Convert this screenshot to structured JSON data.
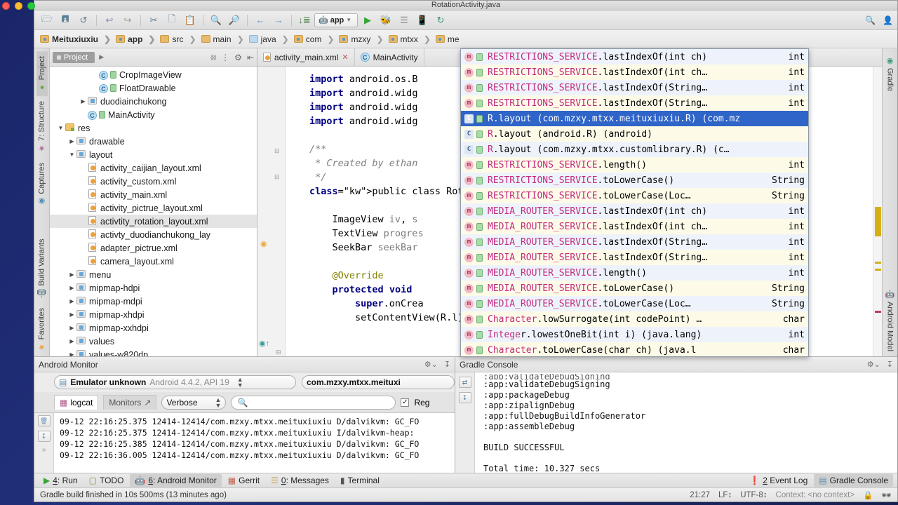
{
  "window": {
    "title": "RotationActivity.java"
  },
  "toolbar": {
    "icons": [
      "open-folder-icon",
      "save-icon",
      "sync-icon",
      "undo-icon",
      "redo-icon",
      "cut-icon",
      "copy-icon",
      "paste-icon",
      "find-icon",
      "find-replace-icon",
      "back-icon",
      "forward-icon",
      "sort-icon"
    ],
    "run_config_label": "app",
    "run_icons": [
      "run-icon",
      "debug-icon",
      "coverage-icon",
      "device-icon",
      "refresh-icon"
    ],
    "right_icons": [
      "search-icon",
      "avatar-icon"
    ]
  },
  "breadcrumb": {
    "items": [
      {
        "label": "Meituxiuxiu",
        "icon": "module-folder-icon",
        "bold": true
      },
      {
        "label": "app",
        "icon": "module-folder-icon",
        "bold": true
      },
      {
        "label": "src",
        "icon": "folder-icon",
        "bold": false
      },
      {
        "label": "main",
        "icon": "folder-icon",
        "bold": false
      },
      {
        "label": "java",
        "icon": "source-folder-icon",
        "bold": false
      },
      {
        "label": "com",
        "icon": "package-folder-icon",
        "bold": false
      },
      {
        "label": "mzxy",
        "icon": "package-folder-icon",
        "bold": false
      },
      {
        "label": "mtxx",
        "icon": "package-folder-icon",
        "bold": false
      },
      {
        "label": "me",
        "icon": "package-folder-icon",
        "bold": false
      }
    ]
  },
  "left_strip": {
    "tabs": [
      "Project",
      "7: Structure",
      "Captures",
      "Build Variants",
      "Favorites"
    ]
  },
  "right_strip": {
    "tabs": [
      "Gradle",
      "Android Model"
    ]
  },
  "project_panel": {
    "tab_label": "Project",
    "tree": [
      {
        "depth": 4,
        "arrow": "none",
        "icon": "class-icon",
        "label": "CropImageView"
      },
      {
        "depth": 4,
        "arrow": "none",
        "icon": "class-icon",
        "label": "FloatDrawable"
      },
      {
        "depth": 3,
        "arrow": "collapsed",
        "icon": "folder-icon",
        "label": "duodiainchukong"
      },
      {
        "depth": 3,
        "arrow": "none",
        "icon": "class-icon",
        "label": "MainActivity"
      },
      {
        "depth": 1,
        "arrow": "expanded",
        "icon": "res-folder-icon",
        "label": "res"
      },
      {
        "depth": 2,
        "arrow": "collapsed",
        "icon": "folder-icon",
        "label": "drawable"
      },
      {
        "depth": 2,
        "arrow": "expanded",
        "icon": "folder-icon",
        "label": "layout"
      },
      {
        "depth": 3,
        "arrow": "none",
        "icon": "xml-icon",
        "label": "activity_caijian_layout.xml"
      },
      {
        "depth": 3,
        "arrow": "none",
        "icon": "xml-icon",
        "label": "activity_custom.xml"
      },
      {
        "depth": 3,
        "arrow": "none",
        "icon": "xml-icon",
        "label": "activity_main.xml"
      },
      {
        "depth": 3,
        "arrow": "none",
        "icon": "xml-icon",
        "label": "activity_pictrue_layout.xml"
      },
      {
        "depth": 3,
        "arrow": "none",
        "icon": "xml-icon",
        "label": "activtity_rotation_layout.xml",
        "selected": true
      },
      {
        "depth": 3,
        "arrow": "none",
        "icon": "xml-icon",
        "label": "activty_duodianchukong_lay"
      },
      {
        "depth": 3,
        "arrow": "none",
        "icon": "xml-icon",
        "label": "adapter_pictrue.xml"
      },
      {
        "depth": 3,
        "arrow": "none",
        "icon": "xml-icon",
        "label": "camera_layout.xml"
      },
      {
        "depth": 2,
        "arrow": "collapsed",
        "icon": "folder-icon",
        "label": "menu"
      },
      {
        "depth": 2,
        "arrow": "collapsed",
        "icon": "folder-icon",
        "label": "mipmap-hdpi"
      },
      {
        "depth": 2,
        "arrow": "collapsed",
        "icon": "folder-icon",
        "label": "mipmap-mdpi"
      },
      {
        "depth": 2,
        "arrow": "collapsed",
        "icon": "folder-icon",
        "label": "mipmap-xhdpi"
      },
      {
        "depth": 2,
        "arrow": "collapsed",
        "icon": "folder-icon",
        "label": "mipmap-xxhdpi"
      },
      {
        "depth": 2,
        "arrow": "collapsed",
        "icon": "folder-icon",
        "label": "values"
      },
      {
        "depth": 2,
        "arrow": "collapsed",
        "icon": "folder-icon",
        "label": "values-w820dp"
      }
    ]
  },
  "editor": {
    "tabs": [
      {
        "label": "activity_main.xml",
        "icon": "xml-icon",
        "closable": true
      },
      {
        "label": "MainActivity",
        "icon": "class-icon",
        "closable": false
      }
    ],
    "lines": [
      {
        "text": "import android.os.B",
        "type": "import"
      },
      {
        "text": "import android.widg",
        "type": "import"
      },
      {
        "text": "import android.widg",
        "type": "import"
      },
      {
        "text": "import android.widg",
        "type": "import"
      },
      {
        "text": "",
        "type": "blank"
      },
      {
        "text": "/**",
        "type": "comment"
      },
      {
        "text": " * Created by ethan",
        "type": "comment"
      },
      {
        "text": " */",
        "type": "comment"
      },
      {
        "text": "public class Rotati",
        "type": "code"
      },
      {
        "text": "",
        "type": "blank"
      },
      {
        "text": "    ImageView iv, s",
        "type": "code"
      },
      {
        "text": "    TextView progres",
        "type": "code"
      },
      {
        "text": "    SeekBar seekBar",
        "type": "code"
      },
      {
        "text": "",
        "type": "blank"
      },
      {
        "text": "    @Override",
        "type": "annotation"
      },
      {
        "text": "    protected void ",
        "type": "code"
      },
      {
        "text": "        super.onCrea",
        "type": "code"
      },
      {
        "text": "        setContentView(R.l);",
        "type": "code"
      }
    ]
  },
  "completion_popup": {
    "items": [
      {
        "icon": "method-icon",
        "name": "RESTRICTIONS_SERVICE",
        "member": ".lastIndexOf(int ch)",
        "type": "int"
      },
      {
        "icon": "method-icon",
        "name": "RESTRICTIONS_SERVICE",
        "member": ".lastIndexOf(int ch…",
        "type": "int"
      },
      {
        "icon": "method-icon",
        "name": "RESTRICTIONS_SERVICE",
        "member": ".lastIndexOf(String…",
        "type": "int"
      },
      {
        "icon": "method-icon",
        "name": "RESTRICTIONS_SERVICE",
        "member": ".lastIndexOf(String…",
        "type": "int"
      },
      {
        "icon": "class-icon",
        "name": "R",
        "member": ".layout",
        "pkg": "(com.mzxy.mtxx.meituxiuxiu.R) (com.mz",
        "type": "",
        "selected": true
      },
      {
        "icon": "class-icon",
        "name": "R",
        "member": ".layout",
        "pkg": "(android.R) (android)",
        "type": ""
      },
      {
        "icon": "class-icon",
        "name": "R",
        "member": ".layout",
        "pkg": "(com.mzxy.mtxx.customlibrary.R) (c…",
        "type": ""
      },
      {
        "icon": "method-icon",
        "name": "RESTRICTIONS_SERVICE",
        "member": ".length()",
        "type": "int"
      },
      {
        "icon": "method-icon",
        "name": "RESTRICTIONS_SERVICE",
        "member": ".toLowerCase()",
        "type": "String"
      },
      {
        "icon": "method-icon",
        "name": "RESTRICTIONS_SERVICE",
        "member": ".toLowerCase(Loc…",
        "type": "String"
      },
      {
        "icon": "method-icon",
        "name": "MEDIA_ROUTER_SERVICE",
        "member": ".lastIndexOf(int ch)",
        "type": "int"
      },
      {
        "icon": "method-icon",
        "name": "MEDIA_ROUTER_SERVICE",
        "member": ".lastIndexOf(int ch…",
        "type": "int"
      },
      {
        "icon": "method-icon",
        "name": "MEDIA_ROUTER_SERVICE",
        "member": ".lastIndexOf(String…",
        "type": "int"
      },
      {
        "icon": "method-icon",
        "name": "MEDIA_ROUTER_SERVICE",
        "member": ".lastIndexOf(String…",
        "type": "int"
      },
      {
        "icon": "method-icon",
        "name": "MEDIA_ROUTER_SERVICE",
        "member": ".length()",
        "type": "int"
      },
      {
        "icon": "method-icon",
        "name": "MEDIA_ROUTER_SERVICE",
        "member": ".toLowerCase()",
        "type": "String"
      },
      {
        "icon": "method-icon",
        "name": "MEDIA_ROUTER_SERVICE",
        "member": ".toLowerCase(Loc…",
        "type": "String"
      },
      {
        "icon": "method-icon",
        "name": "Character",
        "member": ".lowSurrogate(int codePoint) …",
        "type": "char"
      },
      {
        "icon": "method-icon",
        "name": "Intege",
        "member": "r.lowestOneBit(int i) (java.lang)",
        "type": "int"
      },
      {
        "icon": "method-icon",
        "name": "Character",
        "member": ".toLowerCase(char ch) (java.l",
        "type": "char"
      }
    ]
  },
  "android_monitor": {
    "title": "Android Monitor",
    "device": {
      "prefix": "Emulator unknown",
      "suffix": "Android 4.4.2, API 19"
    },
    "process": "com.mzxy.mtxx.meituxi",
    "tabs": [
      {
        "label": "logcat",
        "active": true
      },
      {
        "label": "Monitors",
        "active": false
      }
    ],
    "log_level": "Verbose",
    "search_placeholder": "",
    "regex_label": "Reg",
    "regex_checked": true,
    "log_lines": [
      "09-12 22:16:25.375 12414-12414/com.mzxy.mtxx.meituxiuxiu D/dalvikvm: GC_FO",
      "09-12 22:16:25.375 12414-12414/com.mzxy.mtxx.meituxiuxiu I/dalvikvm-heap:",
      "09-12 22:16:25.385 12414-12414/com.mzxy.mtxx.meituxiuxiu D/dalvikvm: GC_FO",
      "09-12 22:16:36.005 12414-12414/com.mzxy.mtxx.meituxiuxiu D/dalvikvm: GC_FO"
    ]
  },
  "gradle_console": {
    "title": "Gradle Console",
    "lines": [
      ":app:validateDebugSigning",
      ":app:packageDebug",
      ":app:zipalignDebug",
      ":app:fullDebugBuildInfoGenerator",
      ":app:assembleDebug",
      "",
      "BUILD SUCCESSFUL",
      "",
      "Total time: 10.327 secs"
    ]
  },
  "status_tabs": {
    "left": [
      {
        "num": "4",
        "label": ": Run",
        "icon": "run-icon",
        "active": false
      },
      {
        "num": "",
        "label": "TODO",
        "icon": "todo-icon",
        "active": false
      },
      {
        "num": "6",
        "label": ": Android Monitor",
        "icon": "android-icon",
        "active": true
      },
      {
        "num": "",
        "label": "Gerrit",
        "icon": "gerrit-icon",
        "active": false
      },
      {
        "num": "0",
        "label": ": Messages",
        "icon": "messages-icon",
        "active": false
      },
      {
        "num": "",
        "label": "Terminal",
        "icon": "terminal-icon",
        "active": false
      }
    ],
    "right": [
      {
        "num": "2",
        "label": "Event Log",
        "icon": "event-log-icon",
        "active": false
      },
      {
        "num": "",
        "label": "Gradle Console",
        "icon": "gradle-console-icon",
        "active": true
      }
    ]
  },
  "status_bar": {
    "message": "Gradle build finished in 10s 500ms (13 minutes ago)",
    "caret": "21:27",
    "line_sep": "LF",
    "encoding": "UTF-8",
    "context": "Context: <no context>",
    "icons": [
      "lock-icon",
      "inspector-icon"
    ]
  },
  "colors": {
    "accent": "#2f64c8",
    "keyword": "#000080",
    "comment": "#808080",
    "annotation": "#808000",
    "member": "#c2297f",
    "doc_highlight": "#f5f0d8"
  }
}
